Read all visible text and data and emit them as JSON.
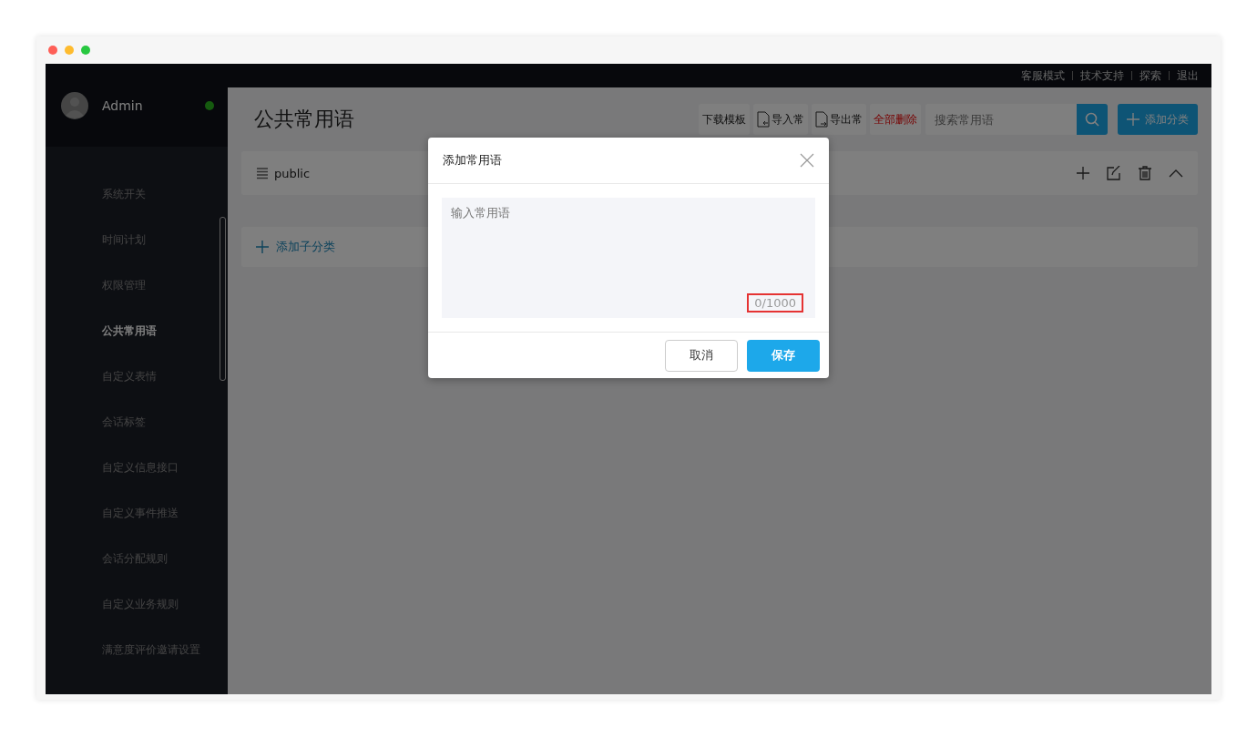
{
  "top_links": [
    "客服模式",
    "技术支持",
    "探索",
    "退出"
  ],
  "user": {
    "name": "Admin",
    "online": true
  },
  "sidebar": {
    "items": [
      {
        "label": "系统开关",
        "selected": false
      },
      {
        "label": "时间计划",
        "selected": false
      },
      {
        "label": "权限管理",
        "selected": false
      },
      {
        "label": "公共常用语",
        "selected": true
      },
      {
        "label": "自定义表情",
        "selected": false
      },
      {
        "label": "会话标签",
        "selected": false
      },
      {
        "label": "自定义信息接口",
        "selected": false
      },
      {
        "label": "自定义事件推送",
        "selected": false
      },
      {
        "label": "会话分配规则",
        "selected": false
      },
      {
        "label": "自定义业务规则",
        "selected": false
      },
      {
        "label": "满意度评价邀请设置",
        "selected": false
      }
    ]
  },
  "page_title": "公共常用语",
  "toolbar": [
    {
      "kind": "plain",
      "label": "下载模板"
    },
    {
      "kind": "import",
      "label": "导入常"
    },
    {
      "kind": "export",
      "label": "导出常"
    },
    {
      "kind": "danger",
      "label": "全部删除"
    }
  ],
  "search": {
    "placeholder": "搜索常用语"
  },
  "add_category": "添加分类",
  "category": {
    "name": "public",
    "expanded": true
  },
  "add_subcategory": "添加子分类",
  "dialog": {
    "title": "添加常用语",
    "placeholder": "输入常用语",
    "counter": "0/1000",
    "counter_highlighted": true,
    "buttons": [
      {
        "kind": "cancel",
        "label": "取消"
      },
      {
        "kind": "primary",
        "label": "保存"
      }
    ]
  }
}
